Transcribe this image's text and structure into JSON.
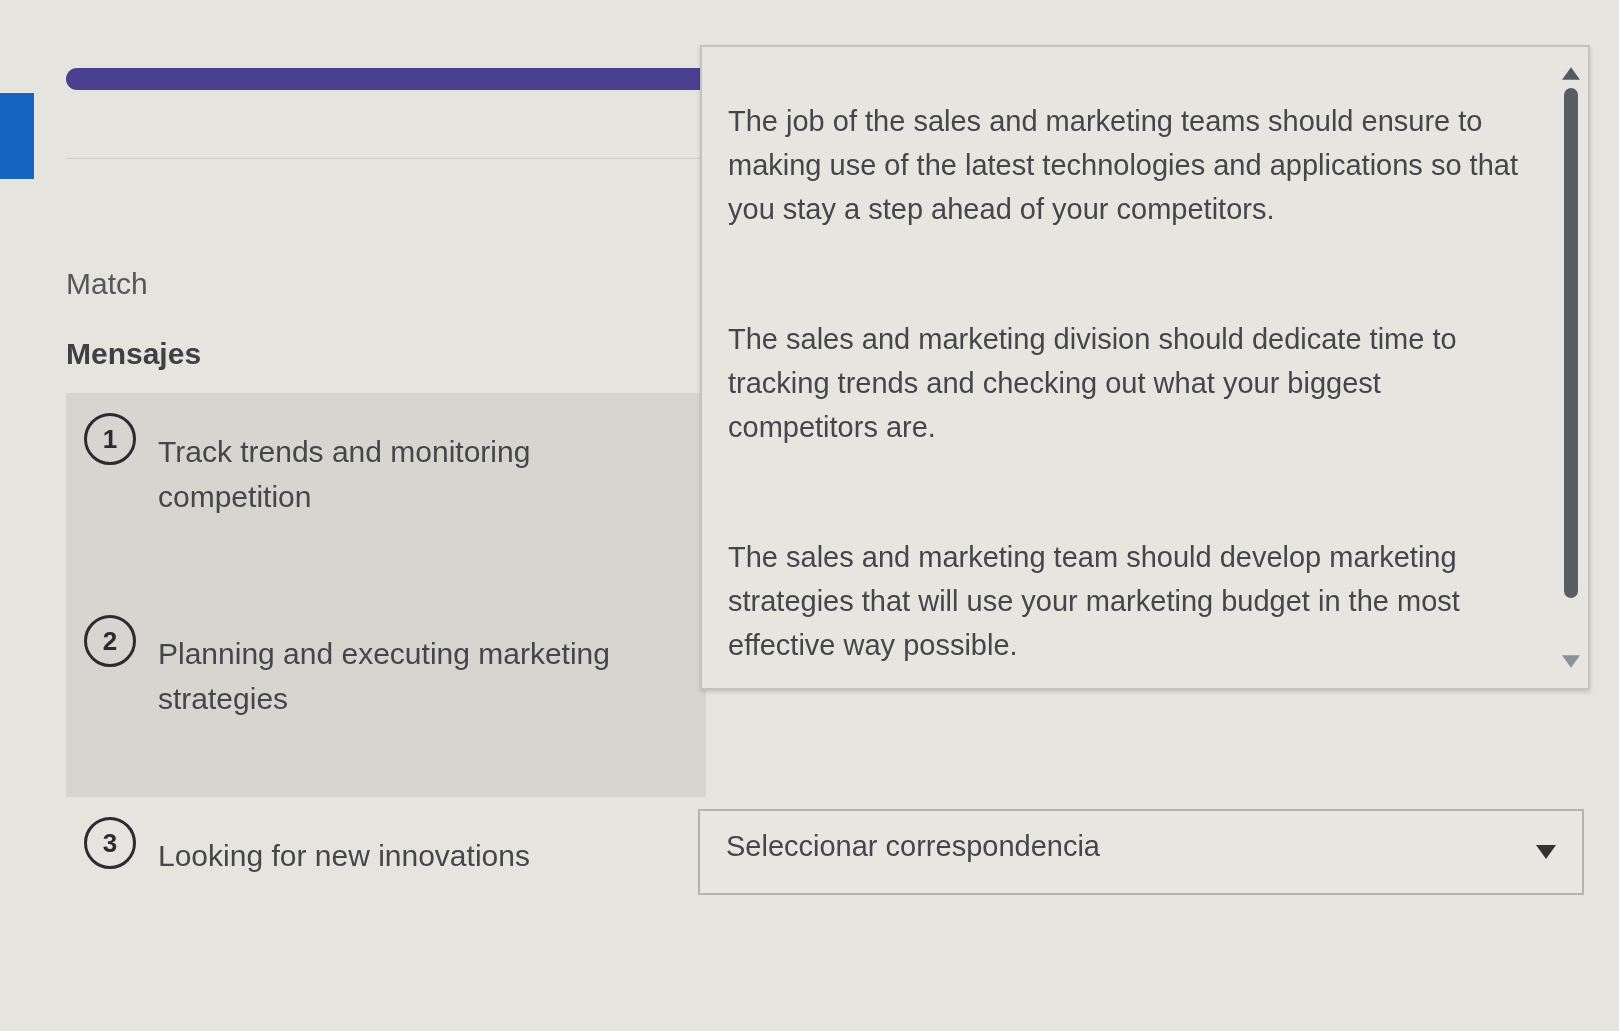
{
  "question": {
    "instruction": "Match",
    "heading": "Mensajes",
    "prompts": [
      {
        "number": "1",
        "text": "Track trends and monitoring competition",
        "highlighted": true
      },
      {
        "number": "2",
        "text": "Planning and executing marketing strategies",
        "highlighted": true
      },
      {
        "number": "3",
        "text": "Looking for new innovations",
        "highlighted": false
      }
    ]
  },
  "open_dropdown": {
    "options": [
      "The job of the sales and marketing teams should ensure to making use of the latest technologies and applications so that you stay a step ahead of your competitors.",
      "The sales and marketing division should dedicate time to tracking trends and checking out what your biggest competitors are.",
      "The sales and marketing team should develop marketing strategies that will use your marketing budget in the most effective way possible."
    ]
  },
  "select": {
    "placeholder": "Seleccionar correspondencia"
  }
}
